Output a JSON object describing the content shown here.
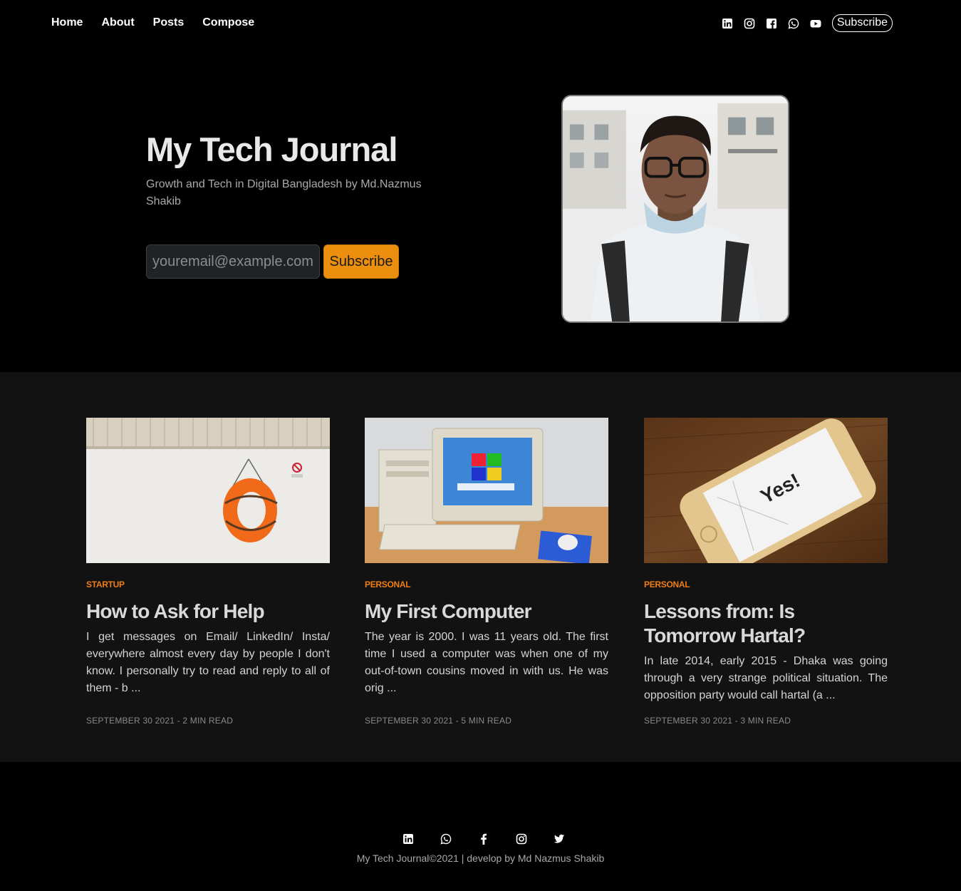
{
  "nav": {
    "links": [
      "Home",
      "About",
      "Posts",
      "Compose"
    ],
    "social_icons": [
      "linkedin-icon",
      "instagram-icon",
      "facebook-icon",
      "whatsapp-icon",
      "youtube-icon"
    ],
    "subscribe_label": "Subscribe"
  },
  "hero": {
    "title": "My Tech Journal",
    "subtitle": "Growth and Tech in Digital Bangladesh by Md.Nazmus Shakib",
    "email_placeholder": "youremail@example.com",
    "subscribe_label": "Subscribe",
    "accent_color": "#ec8f0e"
  },
  "posts": [
    {
      "category": "STARTUP",
      "title": "How to Ask for Help",
      "excerpt": "I get messages on Email/ LinkedIn/ Insta/ everywhere almost every day by people I don't know. I personally try to read and reply to all of them - b ...",
      "meta": "SEPTEMBER 30 2021 - 2 MIN READ"
    },
    {
      "category": "PERSONAL",
      "title": "My First Computer",
      "excerpt": "The year is 2000. I was 11 years old. The first time I used a computer was when one of my out-of-town cousins moved in with us. He was orig ...",
      "meta": "SEPTEMBER 30 2021 - 5 MIN READ"
    },
    {
      "category": "PERSONAL",
      "title": "Lessons from: Is Tomorrow Hartal?",
      "excerpt": "In late 2014, early 2015 - Dhaka was going through a very strange political situation. The opposition party would call hartal (a ...",
      "meta": "SEPTEMBER 30 2021 - 3 MIN READ"
    }
  ],
  "footer": {
    "social_icons": [
      "linkedin-icon",
      "whatsapp-icon",
      "facebook-icon",
      "instagram-icon",
      "twitter-icon"
    ],
    "copyright": "My Tech Journal©2021 | develop by Md Nazmus Shakib"
  },
  "colors": {
    "category": "#ee7d16",
    "posts_bg": "#121212"
  }
}
